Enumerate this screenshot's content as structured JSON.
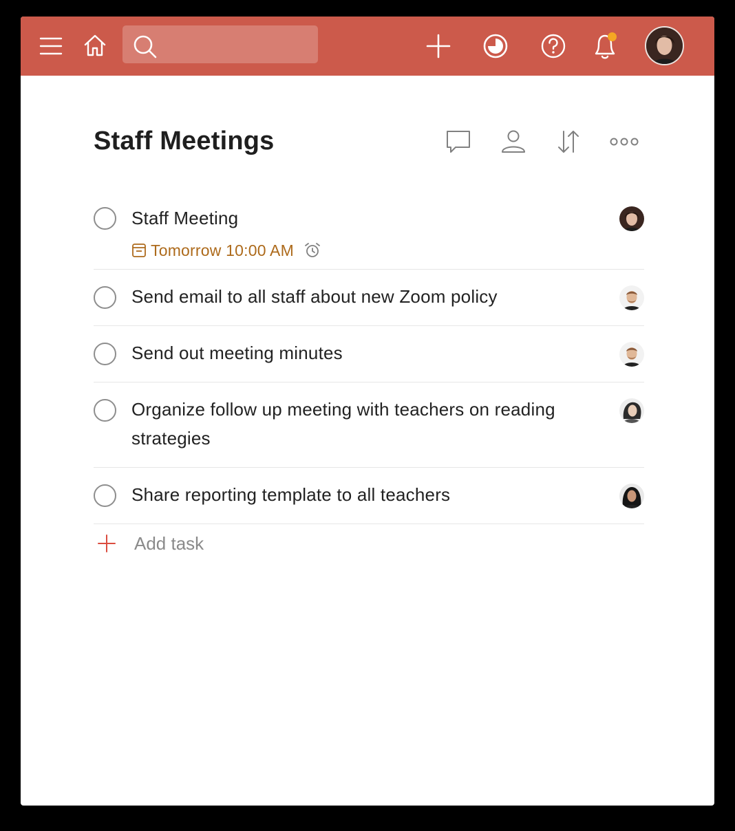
{
  "topbar": {
    "background": "#cc5a4b",
    "icons": {
      "menu": "menu-icon",
      "home": "home-icon",
      "search": "search-icon",
      "add": "plus-icon",
      "productivity": "productivity-icon",
      "help": "help-icon",
      "notifications": "bell-icon"
    },
    "search_placeholder": "",
    "notification_dot_color": "#f5a623"
  },
  "project": {
    "title": "Staff Meetings",
    "actions": [
      "comment-icon",
      "person-icon",
      "sort-icon",
      "more-icon"
    ]
  },
  "tasks": [
    {
      "text": "Staff Meeting",
      "due": "Tomorrow 10:00 AM",
      "due_color": "#ad6a1b",
      "has_reminder": true
    },
    {
      "text": "Send email to all staff about new Zoom policy"
    },
    {
      "text": "Send out meeting minutes"
    },
    {
      "text": "Organize follow up meeting with teachers on reading strategies"
    },
    {
      "text": "Share reporting template to all teachers"
    }
  ],
  "add_task": {
    "label": "Add task",
    "accent": "#db4c3f"
  }
}
